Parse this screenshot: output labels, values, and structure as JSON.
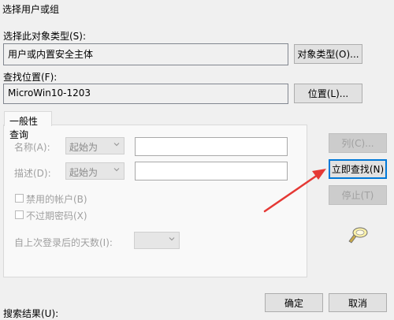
{
  "window": {
    "title": "选择用户或组"
  },
  "object_type": {
    "label": "选择此对象类型(S):",
    "value": "用户或内置安全主体",
    "button": "对象类型(O)..."
  },
  "location": {
    "label": "查找位置(F):",
    "value": "MicroWin10-1203",
    "button": "位置(L)..."
  },
  "tab": {
    "label": "一般性查询"
  },
  "query": {
    "name_label": "名称(A):",
    "name_mode": "起始为",
    "desc_label": "描述(D):",
    "desc_mode": "起始为",
    "disabled_accounts": "禁用的帐户(B)",
    "no_expire_password": "不过期密码(X)",
    "days_since_login": "自上次登录后的天数(I):"
  },
  "side_buttons": {
    "columns": "列(C)...",
    "find_now": "立即查找(N)",
    "stop": "停止(T)"
  },
  "footer": {
    "search_results": "搜索结果(U):",
    "ok": "确定",
    "cancel": "取消"
  },
  "colors": {
    "annotation_arrow": "#e53935",
    "focus": "#0078d7"
  },
  "icons": {
    "search": "search-flashlight-icon",
    "dropdown": "chevron-down-icon"
  }
}
